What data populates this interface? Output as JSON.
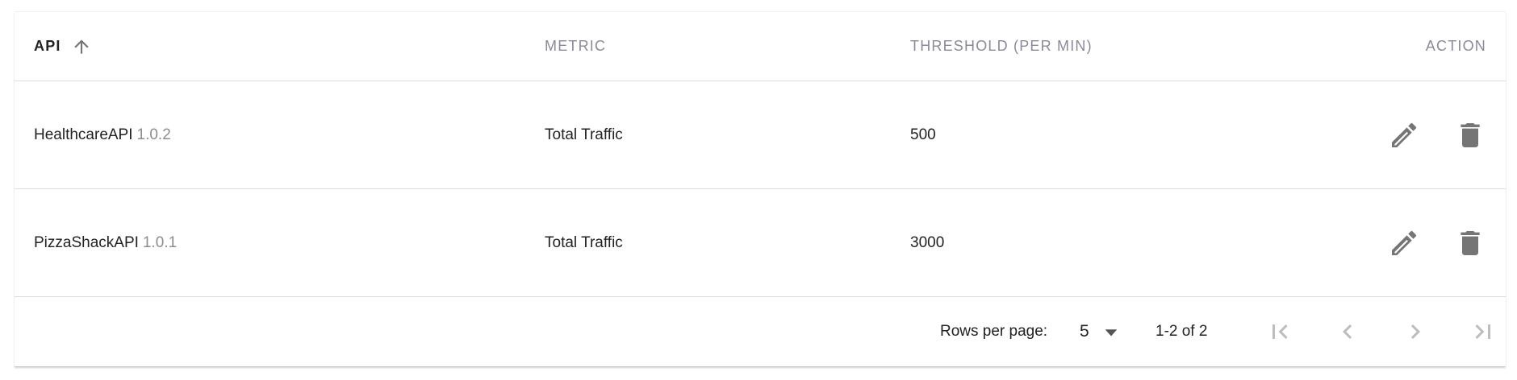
{
  "table": {
    "headers": {
      "api": "API",
      "metric": "METRIC",
      "threshold": "THRESHOLD (PER MIN)",
      "action": "ACTION"
    },
    "sort": {
      "column": "api",
      "direction": "ascending"
    },
    "rows": [
      {
        "api_name": "HealthcareAPI",
        "api_version": "1.0.2",
        "metric": "Total Traffic",
        "threshold": "500"
      },
      {
        "api_name": "PizzaShackAPI",
        "api_version": "1.0.1",
        "metric": "Total Traffic",
        "threshold": "3000"
      }
    ]
  },
  "pagination": {
    "rows_per_page_label": "Rows per page:",
    "rows_per_page_value": "5",
    "range_text": "1-2 of 2"
  },
  "icons": {
    "sort": "arrow-up-icon",
    "edit": "pencil-icon",
    "delete": "trash-icon",
    "first_page": "first-page-icon",
    "prev_page": "chevron-left-icon",
    "next_page": "chevron-right-icon",
    "last_page": "last-page-icon",
    "dropdown": "caret-down-icon"
  },
  "colors": {
    "icon_gray": "#757575",
    "pager_gray": "#bdbdbd",
    "header_text": "#8a8a9a",
    "version_text": "#8d8d8d"
  }
}
